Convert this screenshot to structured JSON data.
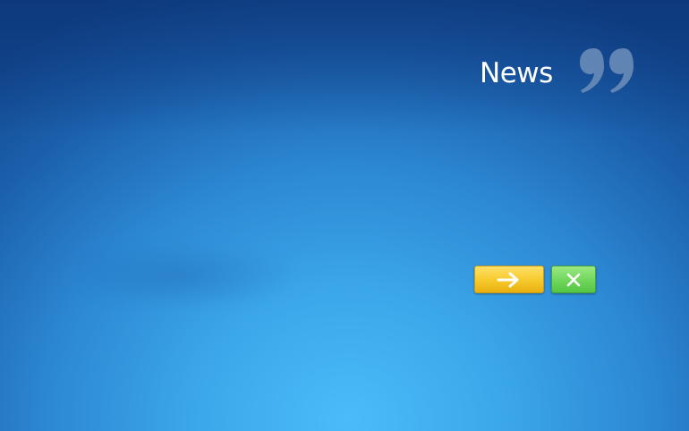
{
  "panel": {
    "title": "News"
  },
  "icons": {
    "quote": "closing-quote-icon",
    "next": "arrow-right-icon",
    "close": "close-icon"
  },
  "colors": {
    "next_button": "#f6c92b",
    "close_button": "#6fd65b",
    "background_light": "#4cbcf8",
    "background_dark": "#12488f"
  }
}
